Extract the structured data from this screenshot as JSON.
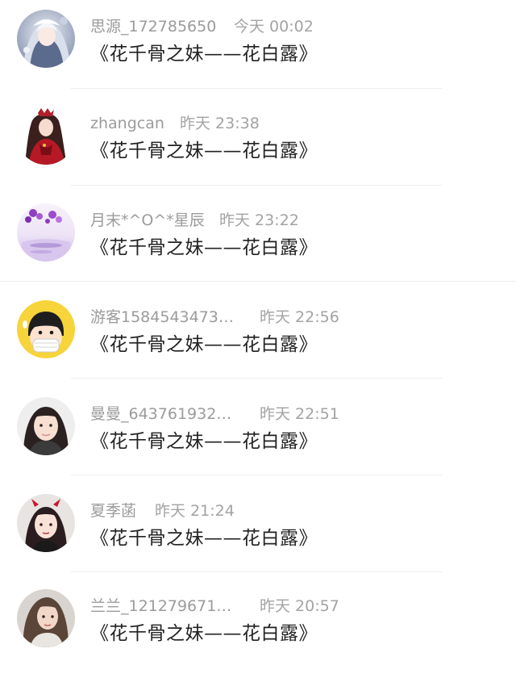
{
  "comments": [
    {
      "username": "思源_172785650",
      "time": "今天 00:02",
      "content": "《花千骨之妹——花白露》",
      "avatar_icon": "anime-girl-white-hair-avatar"
    },
    {
      "username": "zhangcan",
      "time": "昨天 23:38",
      "content": "《花千骨之妹——花白露》",
      "avatar_icon": "anime-girl-red-dress-avatar"
    },
    {
      "username": "月末*^O^*星辰",
      "time": "昨天 23:22",
      "content": "《花千骨之妹——花白露》",
      "avatar_icon": "purple-flowers-avatar"
    },
    {
      "username": "游客1584543473…",
      "time": "昨天 22:56",
      "content": "《花千骨之妹——花白露》",
      "avatar_icon": "cartoon-kid-mask-avatar"
    },
    {
      "username": "曼曼_643761932…",
      "time": "昨天 22:51",
      "content": "《花千骨之妹——花白露》",
      "avatar_icon": "girl-photo-avatar"
    },
    {
      "username": "夏季菡",
      "time": "昨天 21:24",
      "content": "《花千骨之妹——花白露》",
      "avatar_icon": "girl-devil-horns-avatar"
    },
    {
      "username": "兰兰_121279671…",
      "time": "昨天 20:57",
      "content": "《花千骨之妹——花白露》",
      "avatar_icon": "girl-long-hair-avatar"
    }
  ]
}
